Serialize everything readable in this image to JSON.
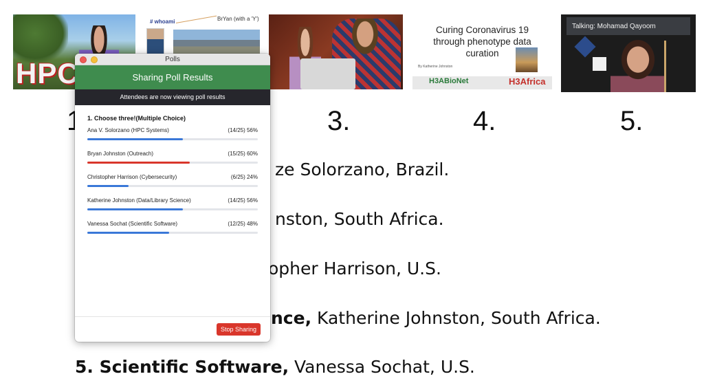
{
  "thumbnails": {
    "t1_text": "HPC",
    "t2_hashtag": "# whoami",
    "t2_note": "BrYan (with a 'Y')",
    "t4_title": "Curing Coronavirus 19 through phenotype data curation",
    "t4_byline": "By Katherine Johnston",
    "t4_logo_left": "H3ABioNet",
    "t4_logo_right": "H3Africa",
    "t5_talking": "Talking: Mohamad Qayoom"
  },
  "slide": {
    "numbers": [
      "1",
      "3.",
      "4.",
      "5."
    ],
    "lines": [
      {
        "bold": "",
        "text": "ze Solorzano, Brazil."
      },
      {
        "bold": "",
        "text": "nston, South Africa."
      },
      {
        "bold": "",
        "text": "opher Harrison, U.S."
      },
      {
        "bold": "nce,",
        "text": " Katherine Johnston, South Africa."
      },
      {
        "bold": "5. Scientific Software,",
        "text": " Vanessa Sochat, U.S."
      }
    ]
  },
  "polls_window": {
    "title": "Polls",
    "header": "Sharing Poll Results",
    "status": "Attendees are now viewing poll results",
    "question": "1. Choose three!(Multiple Choice)",
    "options": [
      {
        "label": "Ana V. Solorzano (HPC Systems)",
        "stat": "(14/25) 56%",
        "percent": 56,
        "color": "#3a78d8"
      },
      {
        "label": "Bryan Johnston (Outreach)",
        "stat": "(15/25) 60%",
        "percent": 60,
        "color": "#d9362b"
      },
      {
        "label": "Christopher Harrison (Cybersecurity)",
        "stat": "(6/25) 24%",
        "percent": 24,
        "color": "#3a78d8"
      },
      {
        "label": "Katherine Johnston (Data/Library Science)",
        "stat": "(14/25) 56%",
        "percent": 56,
        "color": "#3a78d8"
      },
      {
        "label": "Vanessa Sochat (Scientific Software)",
        "stat": "(12/25) 48%",
        "percent": 48,
        "color": "#3a78d8"
      }
    ],
    "stop_button": "Stop Sharing"
  }
}
